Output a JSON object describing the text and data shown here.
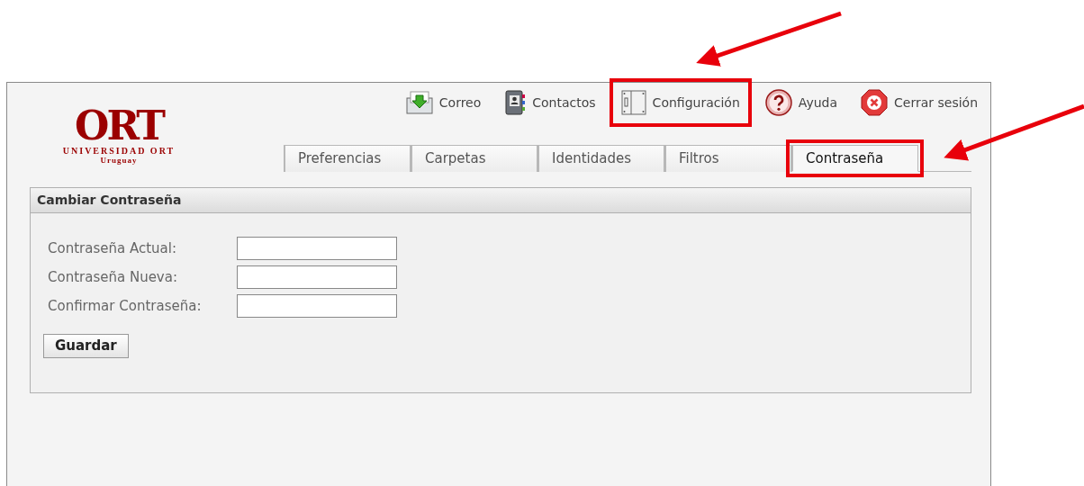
{
  "logo": {
    "mark": "ORT",
    "name": "UNIVERSIDAD ORT",
    "subtitle": "Uruguay"
  },
  "nav": [
    {
      "kind": "mail",
      "label": "Correo",
      "highlighted": false
    },
    {
      "kind": "contacts",
      "label": "Contactos",
      "highlighted": false
    },
    {
      "kind": "settings",
      "label": "Configuración",
      "highlighted": true
    },
    {
      "kind": "help",
      "label": "Ayuda",
      "highlighted": false
    },
    {
      "kind": "logout",
      "label": "Cerrar sesión",
      "highlighted": false
    }
  ],
  "tabs": [
    {
      "label": "Preferencias",
      "selected": false,
      "highlighted": false
    },
    {
      "label": "Carpetas",
      "selected": false,
      "highlighted": false
    },
    {
      "label": "Identidades",
      "selected": false,
      "highlighted": false
    },
    {
      "label": "Filtros",
      "selected": false,
      "highlighted": false
    },
    {
      "label": "Contraseña",
      "selected": true,
      "highlighted": true
    }
  ],
  "panel": {
    "title": "Cambiar Contraseña",
    "fields": [
      {
        "label": "Contraseña Actual:"
      },
      {
        "label": "Contraseña Nueva:"
      },
      {
        "label": "Confirmar Contraseña:"
      }
    ],
    "button": "Guardar"
  }
}
